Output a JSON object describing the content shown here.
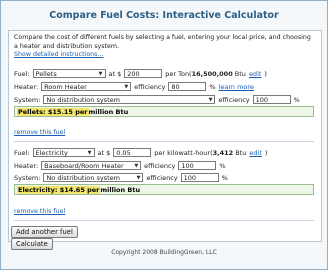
{
  "title": "Compare Fuel Costs: Interactive Calculator",
  "intro": "Compare the cost of different fuels by selecting a fuel, entering your local price, and choosing a heater and distribution system.",
  "show_instructions": "Show detailed instructions...",
  "fuel_label": "Fuel:",
  "heater_label": "Heater:",
  "system_label": "System:",
  "at_label": "at $",
  "efficiency_label": "efficiency",
  "pct": "%",
  "learn_more": "learn more",
  "edit": "edit",
  "remove": "remove this fuel",
  "fuels": [
    {
      "fuel": "Pellets",
      "price": "200",
      "unit_prefix": "per Ton(",
      "unit_btu": "16,500,000",
      "unit_suffix": " Btu",
      "unit_close": ")",
      "heater": "Room Heater",
      "heater_eff": "80",
      "system": "No distribution system",
      "system_eff": "100",
      "result_hl": "Pellets: $15.15 per",
      "result_rest": " million Btu"
    },
    {
      "fuel": "Electricity",
      "price": "0.05",
      "unit_prefix": "per kilowatt-hour(",
      "unit_btu": "3,412",
      "unit_suffix": " Btu",
      "unit_close": ")",
      "heater": "Baseboard/Room Heater",
      "heater_eff": "100",
      "system": "No distribution system",
      "system_eff": "100",
      "result_hl": "Electricity: $14.65 per",
      "result_rest": " million Btu"
    }
  ],
  "add_button": "Add another fuel",
  "calc_button": "Calculate",
  "copyright": "Copyright 2008 BuildingGreen, LLC"
}
